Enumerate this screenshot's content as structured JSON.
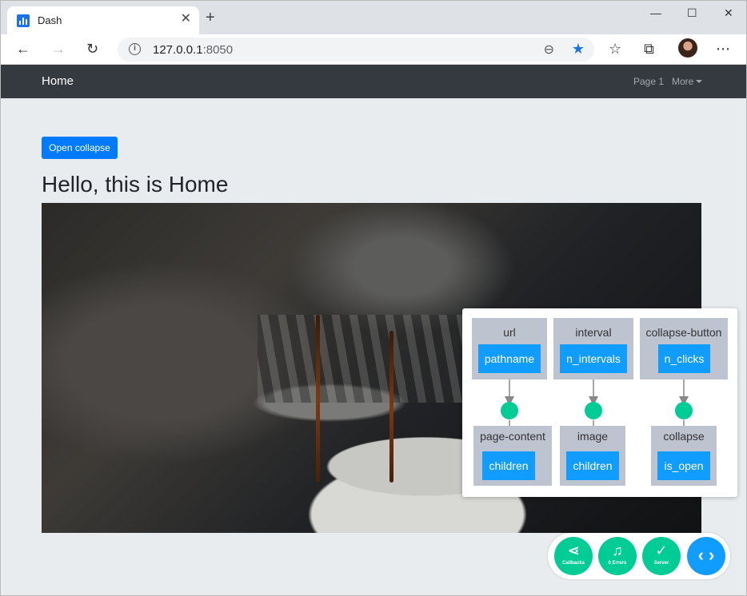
{
  "browser": {
    "tab_title": "Dash",
    "url_host": "127.0.0.1",
    "url_port": ":8050"
  },
  "navbar": {
    "brand": "Home",
    "links": [
      {
        "label": "Page 1"
      },
      {
        "label": "More"
      }
    ]
  },
  "main": {
    "collapse_button_label": "Open collapse",
    "heading": "Hello, this is Home"
  },
  "callback_graph": {
    "inputs": [
      {
        "component": "url",
        "property": "pathname"
      },
      {
        "component": "interval",
        "property": "n_intervals"
      },
      {
        "component": "collapse-button",
        "property": "n_clicks"
      }
    ],
    "outputs": [
      {
        "component": "page-content",
        "property": "children"
      },
      {
        "component": "image",
        "property": "children"
      },
      {
        "component": "collapse",
        "property": "is_open"
      }
    ]
  },
  "devtools": {
    "buttons": [
      {
        "label": "Callbacks",
        "icon": "share-icon"
      },
      {
        "label": "0 Errors",
        "icon": "bell-icon"
      },
      {
        "label": "Server",
        "icon": "check-icon"
      }
    ],
    "toggle_icon": "code-icon"
  },
  "colors": {
    "navbar": "#343a40",
    "primary": "#007bff",
    "dash_blue": "#119dff",
    "dash_green": "#00cc96",
    "node_gray": "#bdc3cf"
  }
}
